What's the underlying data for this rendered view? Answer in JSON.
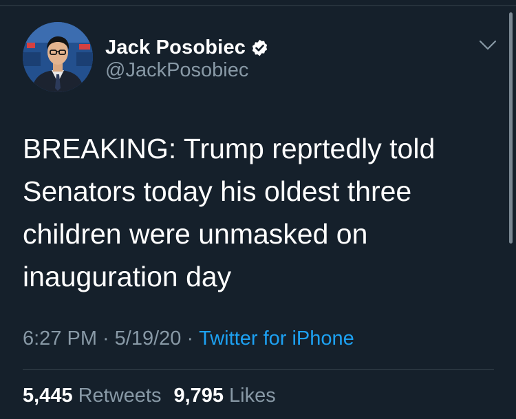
{
  "author": {
    "display_name": "Jack Posobiec",
    "handle": "@JackPosobiec",
    "verified": true
  },
  "tweet": {
    "text": "BREAKING: Trump reprtedly told\nSenators today his oldest three\nchildren were unmasked on\ninauguration day"
  },
  "meta": {
    "time": "6:27 PM",
    "separator": "·",
    "date": "5/19/20",
    "source": "Twitter for iPhone"
  },
  "stats": {
    "retweets_count": "5,445",
    "retweets_label": "Retweets",
    "likes_count": "9,795",
    "likes_label": "Likes"
  },
  "icons": {
    "verified": "verified-badge-icon",
    "more": "chevron-down-icon"
  },
  "colors": {
    "background": "#15202b",
    "secondary_text": "#8899a6",
    "link": "#1da1f2",
    "divider": "#38444d"
  }
}
